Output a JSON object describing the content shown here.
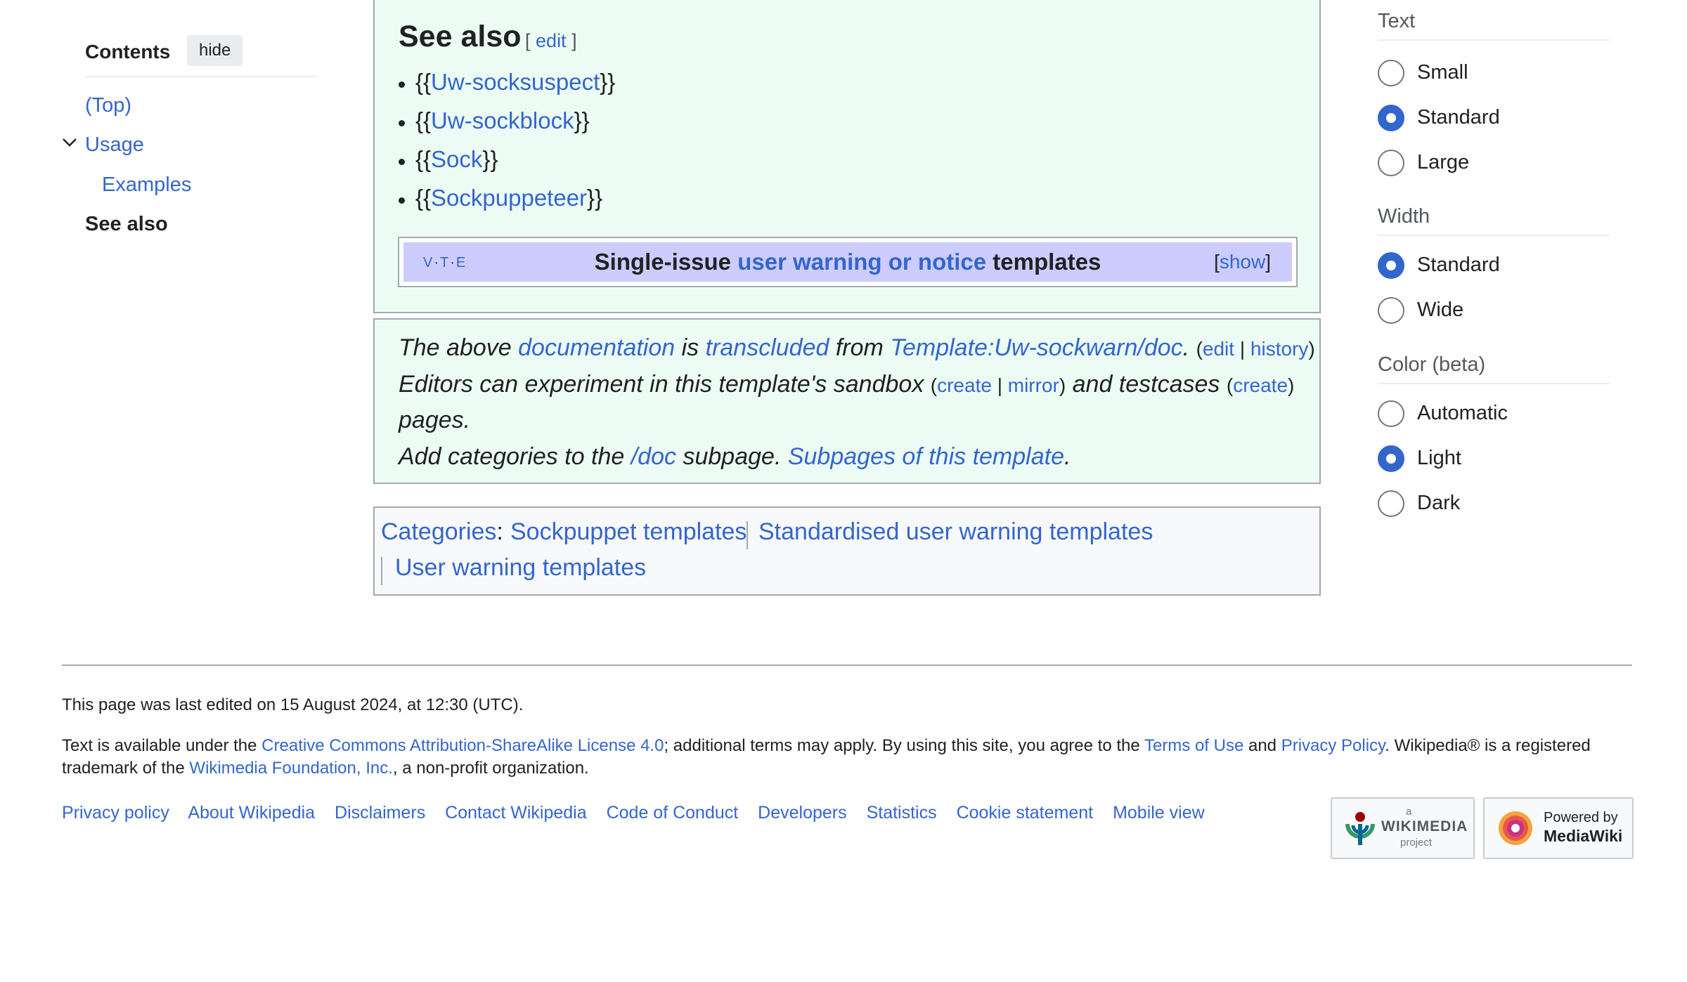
{
  "toc": {
    "title": "Contents",
    "hide_label": "hide",
    "items": [
      "(Top)",
      "Usage",
      "Examples",
      "See also"
    ]
  },
  "see_also": {
    "heading": "See also",
    "edit_open": "[",
    "edit_label": "edit",
    "edit_close": "]",
    "list": [
      {
        "pre": "{{",
        "link": "Uw-socksuspect",
        "post": "}}"
      },
      {
        "pre": "{{",
        "link": "Uw-sockblock",
        "post": "}}"
      },
      {
        "pre": "{{",
        "link": "Sock",
        "post": "}}"
      },
      {
        "pre": "{{",
        "link": "Sockpuppeteer",
        "post": "}}"
      }
    ]
  },
  "navbox": {
    "vte": [
      "V",
      "T",
      "E"
    ],
    "title_pre": "Single-issue ",
    "title_link": "user warning or notice",
    "title_post": " templates",
    "show_open": "[",
    "show_label": "show",
    "show_close": "]"
  },
  "doc_notice": {
    "l1_a": "The above ",
    "l1_link1": "documentation",
    "l1_b": " is ",
    "l1_link2": "transcluded",
    "l1_c": " from ",
    "l1_link3": "Template:Uw-sockwarn/doc",
    "l1_d": ". ",
    "edit": "edit",
    "history": "history",
    "l2_a": "Editors can experiment in this template's sandbox ",
    "create": "create",
    "mirror": "mirror",
    "l2_b": " and testcases ",
    "create2": "create",
    "l3": "pages.",
    "l4_a": "Add categories to the ",
    "l4_link1": "/doc",
    "l4_b": " subpage. ",
    "l4_link2": "Subpages of this template",
    "l4_c": "."
  },
  "categories": {
    "label": "Categories",
    "items": [
      "Sockpuppet templates",
      "Standardised user warning templates",
      "User warning templates"
    ]
  },
  "options": {
    "text_heading": "Text",
    "text_options": [
      "Small",
      "Standard",
      "Large"
    ],
    "text_selected": "Standard",
    "width_heading": "Width",
    "width_options": [
      "Standard",
      "Wide"
    ],
    "width_selected": "Standard",
    "color_heading": "Color (beta)",
    "color_options": [
      "Automatic",
      "Light",
      "Dark"
    ],
    "color_selected": "Light"
  },
  "footer": {
    "last_edited": "This page was last edited on 15 August 2024, at 12:30 (UTC).",
    "lic_a": "Text is available under the ",
    "lic_link": "Creative Commons Attribution-ShareAlike License 4.0",
    "lic_b": "; additional terms may apply. By using this site, you agree to the ",
    "terms": "Terms of Use",
    "and": " and ",
    "privacy": "Privacy Policy",
    "lic_c": ". Wikipedia® is a registered",
    "lic_d": "trademark of the ",
    "wmf": "Wikimedia Foundation, Inc.",
    "lic_e": ", a non-profit organization.",
    "links": [
      "Privacy policy",
      "About Wikipedia",
      "Disclaimers",
      "Contact Wikipedia",
      "Code of Conduct",
      "Developers",
      "Statistics",
      "Cookie statement",
      "Mobile view"
    ],
    "badge1_small": "a",
    "badge1_big": "WIKIMEDIA",
    "badge1_sub": "project",
    "badge2_small": "Powered by",
    "badge2_big": "MediaWiki"
  },
  "colors": {
    "link": "#3366cc",
    "doc_bg": "#ecfcf4",
    "navbox_bg": "#ccccff",
    "border": "#a2a9b1"
  }
}
